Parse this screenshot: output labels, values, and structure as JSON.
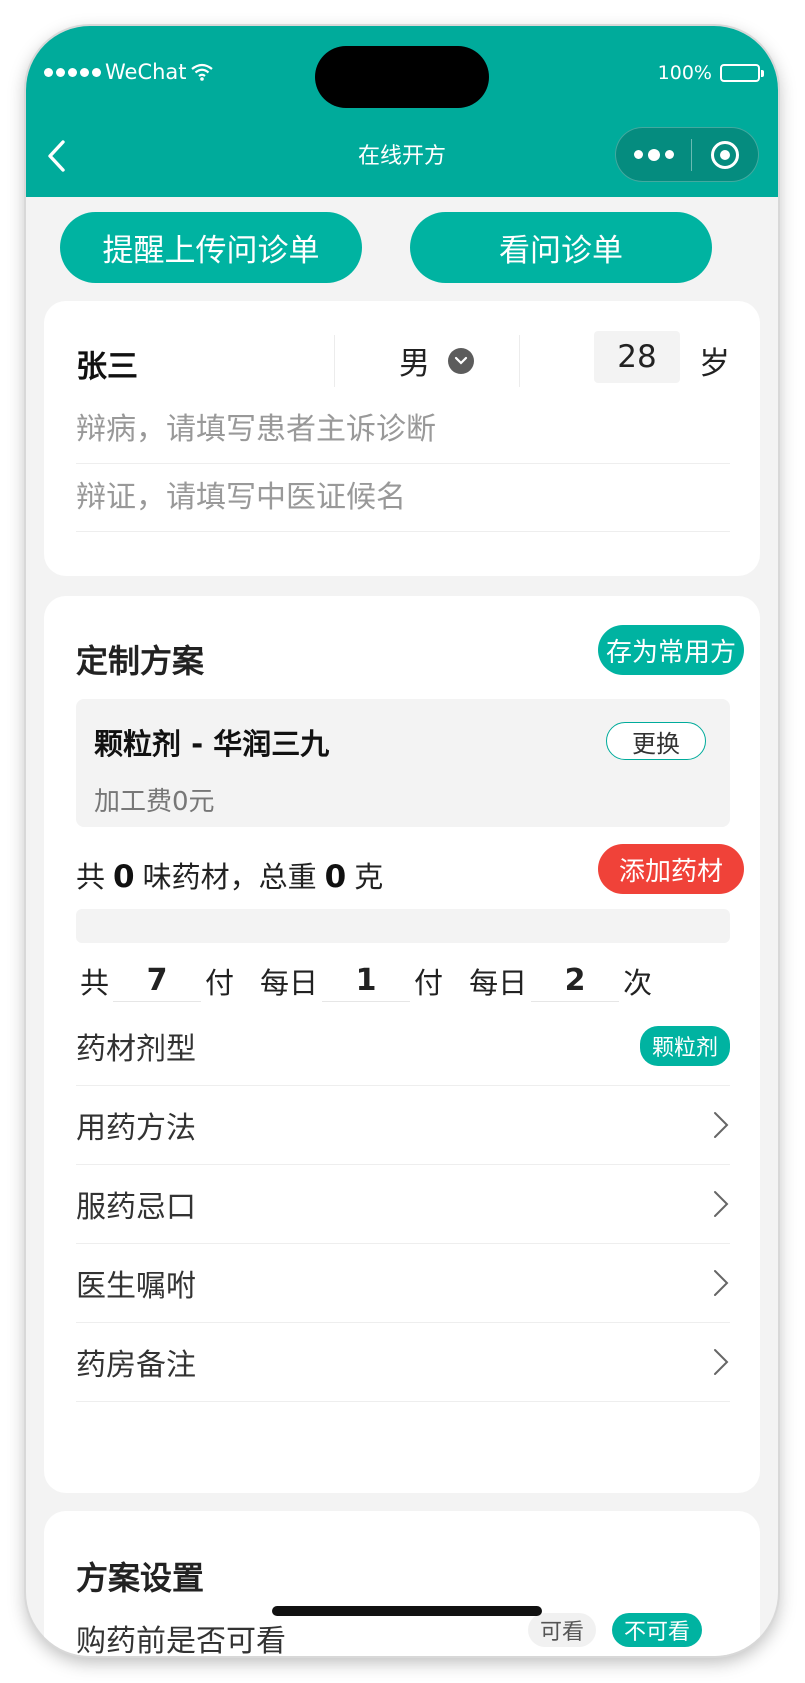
{
  "status_bar": {
    "carrier": "WeChat",
    "battery": "100%"
  },
  "nav": {
    "title": "在线开方"
  },
  "top_buttons": {
    "remind": "提醒上传问诊单",
    "view": "看问诊单"
  },
  "patient": {
    "name": "张三",
    "gender": "男",
    "age": "28",
    "age_unit": "岁",
    "disease_placeholder": "辩病，请填写患者主诉诊断",
    "syndrome_placeholder": "辩证，请填写中医证候名"
  },
  "plan": {
    "title": "定制方案",
    "save_label": "存为常用方",
    "type_name": "颗粒剂 - 华润三九",
    "fee": "加工费0元",
    "change_label": "更换",
    "total_prefix": "共",
    "herb_count": "0",
    "total_mid": "味药材，总重",
    "weight": "0",
    "total_unit": "克",
    "add_label": "添加药材",
    "dose": {
      "l1": "共",
      "packs": "7",
      "l2": "付",
      "l3": "每日",
      "per_day_packs": "1",
      "l4": "付",
      "l5": "每日",
      "times": "2",
      "l6": "次"
    },
    "rows": [
      {
        "label": "药材剂型",
        "badge": "颗粒剂"
      },
      {
        "label": "用药方法"
      },
      {
        "label": "服药忌口"
      },
      {
        "label": "医生嘱咐"
      },
      {
        "label": "药房备注"
      }
    ]
  },
  "settings": {
    "title": "方案设置",
    "view_label": "购药前是否可看",
    "can_view": "可看",
    "cannot_view": "不可看"
  }
}
